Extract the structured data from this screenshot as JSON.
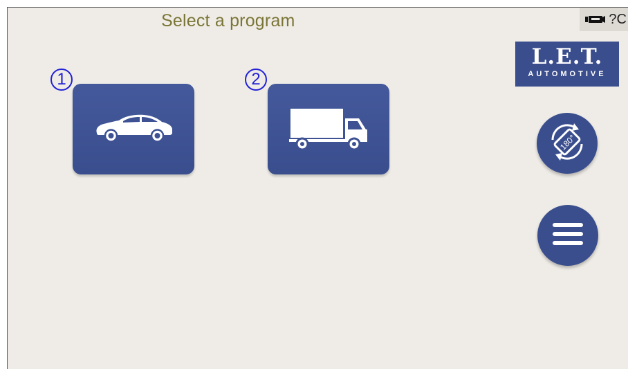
{
  "screen": {
    "title": "Select a program",
    "status_text": "?C"
  },
  "logo": {
    "main": "L.E.T.",
    "sub": "AUTOMOTIVE"
  },
  "programs": [
    {
      "number": "1",
      "icon": "car-icon"
    },
    {
      "number": "2",
      "icon": "truck-icon"
    }
  ],
  "side_buttons": {
    "rotate_label": "180°",
    "rotate_icon": "rotate-screen-icon",
    "menu_icon": "hamburger-menu-icon"
  },
  "colors": {
    "accent": "#3a4e8e",
    "title": "#7a7536",
    "background": "#efece7",
    "badge": "#2222d6"
  }
}
